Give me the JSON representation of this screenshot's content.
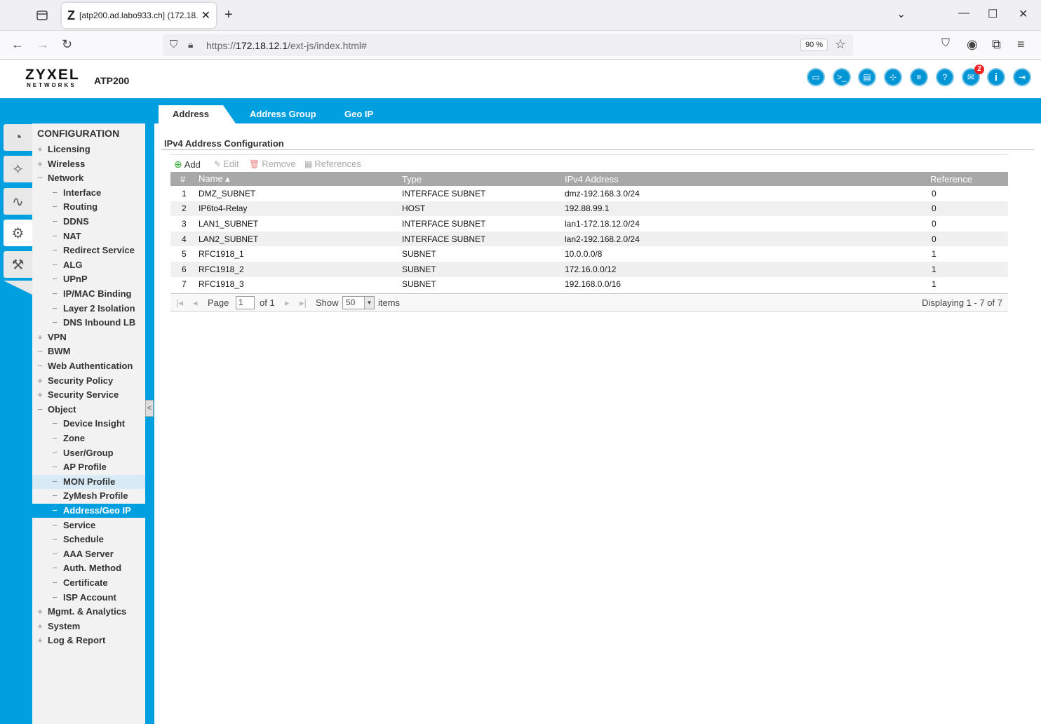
{
  "browser": {
    "tab_title": "[atp200.ad.labo933.ch] (172.18.",
    "tab_favicon": "Z",
    "url_prefix": "https://",
    "url_host": "172.18.12.1",
    "url_path": "/ext-js/index.html#",
    "zoom": "90 %"
  },
  "header": {
    "logo": "ZYXEL",
    "logo_sub": "NETWORKS",
    "model": "ATP200",
    "notification_count": "2",
    "icons": [
      "console-icon",
      "cli-icon",
      "monitor-icon",
      "network-map-icon",
      "chat-icon",
      "help-icon",
      "notification-icon",
      "info-icon",
      "logout-icon"
    ]
  },
  "tabs": [
    "Address",
    "Address Group",
    "Geo IP"
  ],
  "sidebar": {
    "title": "CONFIGURATION",
    "items": [
      {
        "label": "Licensing",
        "mark": "+",
        "child": false
      },
      {
        "label": "Wireless",
        "mark": "+",
        "child": false
      },
      {
        "label": "Network",
        "mark": "−",
        "child": false
      },
      {
        "label": "Interface",
        "mark": "−",
        "child": true
      },
      {
        "label": "Routing",
        "mark": "−",
        "child": true
      },
      {
        "label": "DDNS",
        "mark": "−",
        "child": true
      },
      {
        "label": "NAT",
        "mark": "−",
        "child": true
      },
      {
        "label": "Redirect Service",
        "mark": "−",
        "child": true
      },
      {
        "label": "ALG",
        "mark": "−",
        "child": true
      },
      {
        "label": "UPnP",
        "mark": "−",
        "child": true
      },
      {
        "label": "IP/MAC Binding",
        "mark": "−",
        "child": true
      },
      {
        "label": "Layer 2 Isolation",
        "mark": "−",
        "child": true
      },
      {
        "label": "DNS Inbound LB",
        "mark": "−",
        "child": true
      },
      {
        "label": "VPN",
        "mark": "+",
        "child": false
      },
      {
        "label": "BWM",
        "mark": "−",
        "child": false
      },
      {
        "label": "Web Authentication",
        "mark": "−",
        "child": false
      },
      {
        "label": "Security Policy",
        "mark": "+",
        "child": false
      },
      {
        "label": "Security Service",
        "mark": "+",
        "child": false
      },
      {
        "label": "Object",
        "mark": "−",
        "child": false
      },
      {
        "label": "Device Insight",
        "mark": "−",
        "child": true
      },
      {
        "label": "Zone",
        "mark": "−",
        "child": true
      },
      {
        "label": "User/Group",
        "mark": "−",
        "child": true
      },
      {
        "label": "AP Profile",
        "mark": "−",
        "child": true
      },
      {
        "label": "MON Profile",
        "mark": "−",
        "child": true,
        "state": "hover"
      },
      {
        "label": "ZyMesh Profile",
        "mark": "−",
        "child": true
      },
      {
        "label": "Address/Geo IP",
        "mark": "−",
        "child": true,
        "state": "selected"
      },
      {
        "label": "Service",
        "mark": "−",
        "child": true
      },
      {
        "label": "Schedule",
        "mark": "−",
        "child": true
      },
      {
        "label": "AAA Server",
        "mark": "−",
        "child": true
      },
      {
        "label": "Auth. Method",
        "mark": "−",
        "child": true
      },
      {
        "label": "Certificate",
        "mark": "−",
        "child": true
      },
      {
        "label": "ISP Account",
        "mark": "−",
        "child": true
      },
      {
        "label": "Mgmt. & Analytics",
        "mark": "+",
        "child": false
      },
      {
        "label": "System",
        "mark": "+",
        "child": false
      },
      {
        "label": "Log & Report",
        "mark": "+",
        "child": false
      }
    ]
  },
  "section_title": "IPv4 Address Configuration",
  "toolbar": {
    "add": "Add",
    "edit": "Edit",
    "remove": "Remove",
    "references": "References"
  },
  "table": {
    "columns": [
      "#",
      "Name ▴",
      "Type",
      "IPv4 Address",
      "Reference"
    ],
    "rows": [
      [
        "1",
        "DMZ_SUBNET",
        "INTERFACE SUBNET",
        "dmz-192.168.3.0/24",
        "0"
      ],
      [
        "2",
        "IP6to4-Relay",
        "HOST",
        "192.88.99.1",
        "0"
      ],
      [
        "3",
        "LAN1_SUBNET",
        "INTERFACE SUBNET",
        "lan1-172.18.12.0/24",
        "0"
      ],
      [
        "4",
        "LAN2_SUBNET",
        "INTERFACE SUBNET",
        "lan2-192.168.2.0/24",
        "0"
      ],
      [
        "5",
        "RFC1918_1",
        "SUBNET",
        "10.0.0.0/8",
        "1"
      ],
      [
        "6",
        "RFC1918_2",
        "SUBNET",
        "172.16.0.0/12",
        "1"
      ],
      [
        "7",
        "RFC1918_3",
        "SUBNET",
        "192.168.0.0/16",
        "1"
      ]
    ]
  },
  "pager": {
    "page_label": "Page",
    "page_value": "1",
    "of_label": "of 1",
    "show_label": "Show",
    "show_value": "50",
    "items_label": "items",
    "display": "Displaying 1 - 7 of 7"
  },
  "colors": {
    "accent": "#009fe0"
  }
}
